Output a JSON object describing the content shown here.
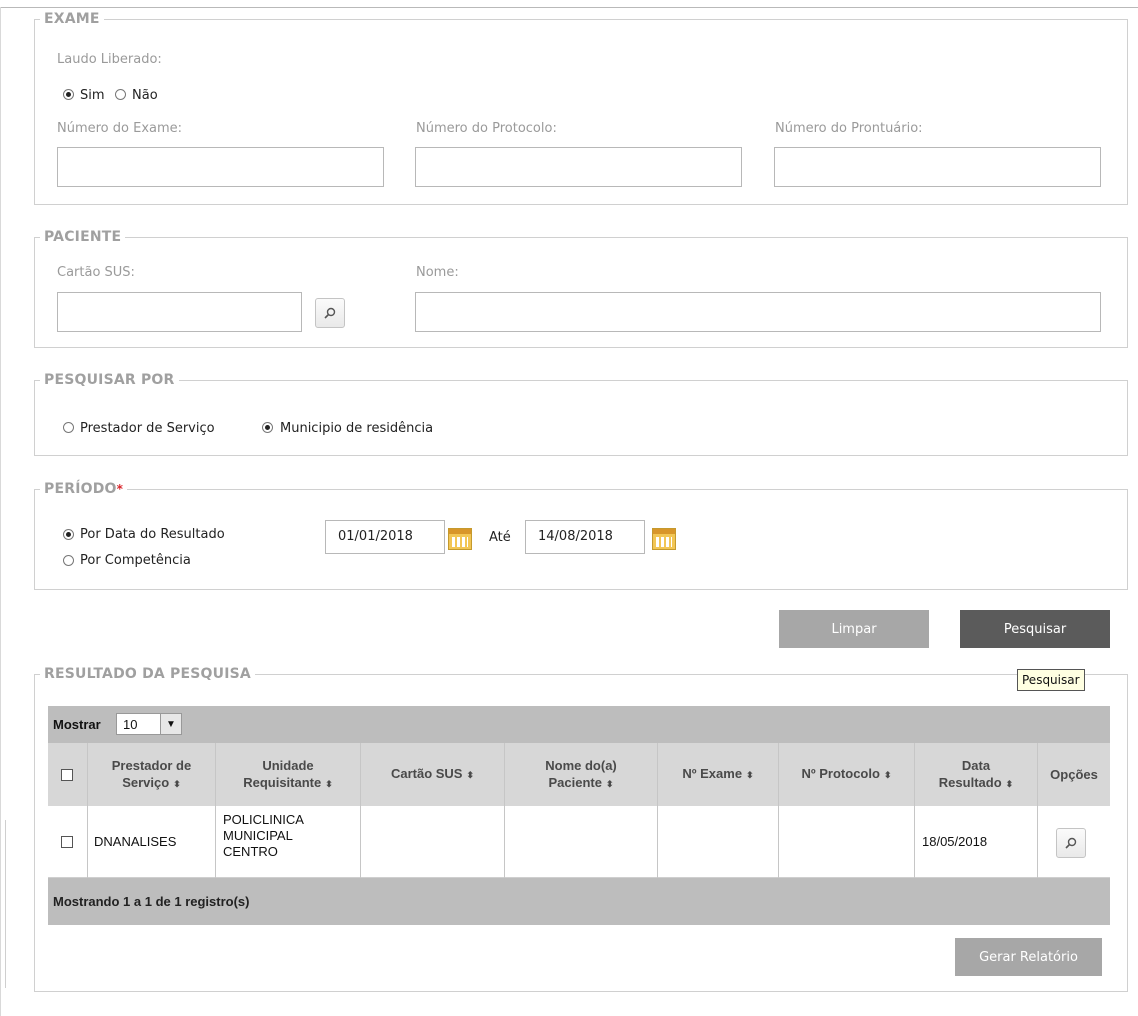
{
  "exame": {
    "title": "EXAME",
    "laudo_label": "Laudo Liberado:",
    "sim_label": "Sim",
    "nao_label": "Não",
    "numero_exame_label": "Número do Exame:",
    "numero_protocolo_label": "Número do Protocolo:",
    "numero_prontuario_label": "Número do Prontuário:",
    "laudo_selected": "Sim"
  },
  "paciente": {
    "title": "PACIENTE",
    "cartao_label": "Cartão SUS:",
    "nome_label": "Nome:"
  },
  "pesquisar_por": {
    "title": "PESQUISAR POR",
    "prestador_label": "Prestador de Serviço",
    "municipio_label": "Municipio de residência",
    "selected": "Municipio de residência"
  },
  "periodo": {
    "title": "PERÍODO",
    "required_mark": "*",
    "por_data_label": "Por Data do Resultado",
    "por_competencia_label": "Por Competência",
    "data_inicio": "01/01/2018",
    "ate_label": "Até",
    "data_fim": "14/08/2018",
    "selected": "Por Data do Resultado"
  },
  "actions": {
    "limpar_label": "Limpar",
    "pesquisar_label": "Pesquisar",
    "tooltip": "Pesquisar"
  },
  "resultado": {
    "title": "RESULTADO DA PESQUISA",
    "mostrar_label": "Mostrar",
    "page_size": "10",
    "columns": {
      "prestador_1": "Prestador de",
      "prestador_2": "Serviço",
      "unidade_1": "Unidade",
      "unidade_2": "Requisitante",
      "cartao": "Cartão SUS",
      "nome_1": "Nome do(a)",
      "nome_2": "Paciente",
      "exame": "Nº Exame",
      "protocolo": "Nº Protocolo",
      "data_1": "Data",
      "data_2": "Resultado",
      "opcoes": "Opções"
    },
    "rows": [
      {
        "prestador": "DNANALISES",
        "unidade_1": "POLICLINICA",
        "unidade_2": "MUNICIPAL",
        "unidade_3": "CENTRO",
        "cartao": "",
        "nome": "",
        "exame": "",
        "protocolo": "",
        "data": "18/05/2018"
      }
    ],
    "footer": "Mostrando 1 a 1 de 1 registro(s)",
    "gerar_label": "Gerar Relatório"
  },
  "colors": {
    "limpar_bg": "#a7a7a7",
    "pesquisar_bg": "#5b5b5b",
    "gerar_bg": "#a7a7a7",
    "section_title": "#a0a0a0"
  }
}
